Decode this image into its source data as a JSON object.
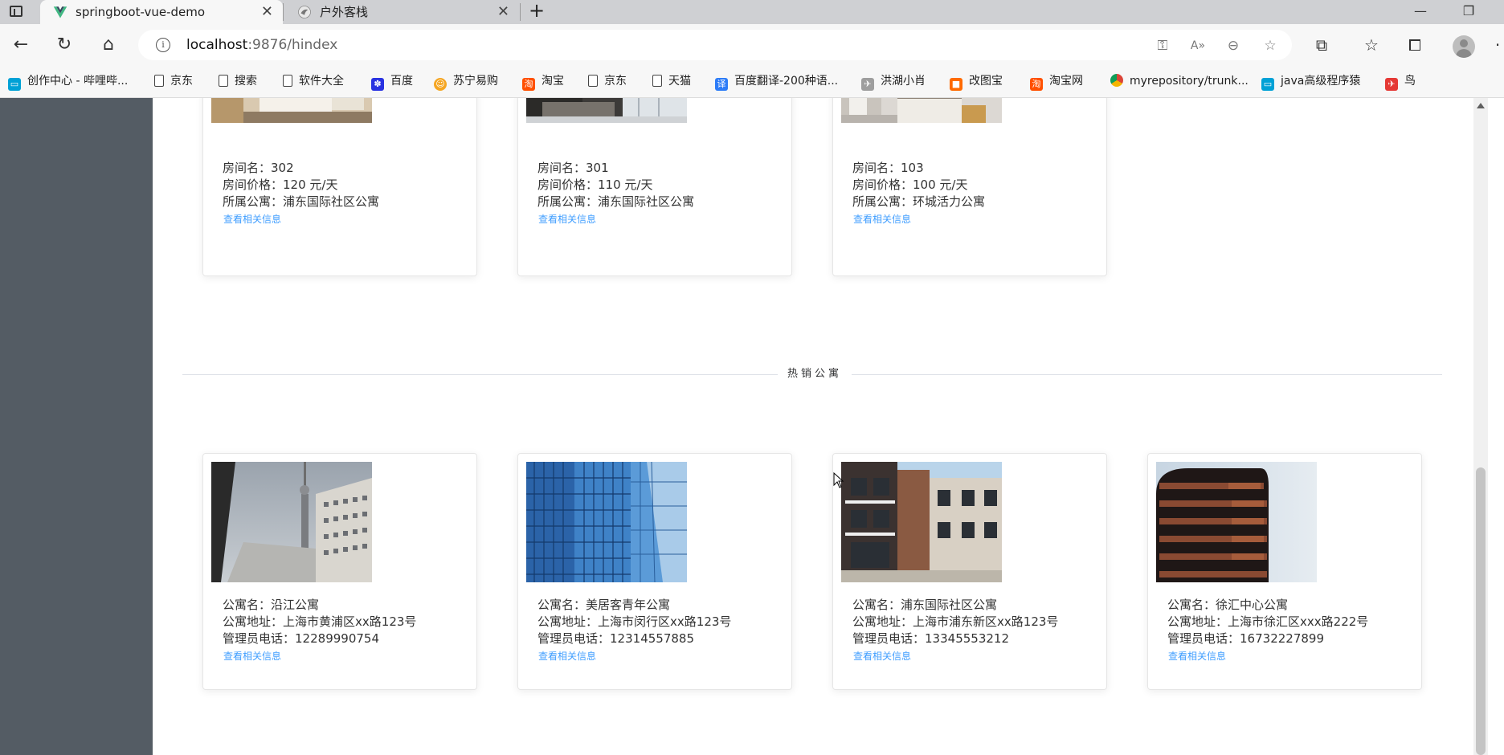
{
  "browser": {
    "tabs": [
      {
        "title": "springboot-vue-demo",
        "active": true,
        "icon": "vue-logo-icon"
      },
      {
        "title": "户外客栈",
        "active": false,
        "icon": "bird-favicon-icon"
      }
    ],
    "address": {
      "host": "localhost",
      "port_path": ":9876/hindex"
    },
    "bookmarks": [
      {
        "label": "创作中心 - 哔哩哔...",
        "icon": "bilibili-icon",
        "color": "#00a1d6"
      },
      {
        "label": "京东",
        "icon": "page-icon"
      },
      {
        "label": "搜索",
        "icon": "page-icon"
      },
      {
        "label": "软件大全",
        "icon": "page-icon"
      },
      {
        "label": "百度",
        "icon": "baidu-paw-icon",
        "color": "#2932e1"
      },
      {
        "label": "苏宁易购",
        "icon": "suning-icon",
        "color": "#f5a623"
      },
      {
        "label": "淘宝",
        "icon": "taobao-icon",
        "color": "#ff5000"
      },
      {
        "label": "京东",
        "icon": "page-icon"
      },
      {
        "label": "天猫",
        "icon": "page-icon"
      },
      {
        "label": "百度翻译-200种语...",
        "icon": "translate-icon",
        "color": "#2d7cf7"
      },
      {
        "label": "洪湖小肖",
        "icon": "bird-icon",
        "color": "#555555"
      },
      {
        "label": "改图宝",
        "icon": "gaitubao-icon",
        "color": "#ff6a00"
      },
      {
        "label": "淘宝网",
        "icon": "taobao-icon",
        "color": "#ff5000"
      },
      {
        "label": "myrepository/trunk...",
        "icon": "chrome-icon",
        "color": "#db4437"
      },
      {
        "label": "java高级程序猿",
        "icon": "bilibili-icon",
        "color": "#00a1d6"
      },
      {
        "label": "鸟",
        "icon": "red-bird-icon",
        "color": "#e53935"
      }
    ]
  },
  "rooms": [
    {
      "name_label": "房间名：",
      "name": "302",
      "price_label": "房间价格：",
      "price": "120 元/天",
      "apt_label": "所属公寓：",
      "apartment": "浦东国际社区公寓",
      "link": "查看相关信息"
    },
    {
      "name_label": "房间名：",
      "name": "301",
      "price_label": "房间价格：",
      "price": "110 元/天",
      "apt_label": "所属公寓：",
      "apartment": "浦东国际社区公寓",
      "link": "查看相关信息"
    },
    {
      "name_label": "房间名：",
      "name": "103",
      "price_label": "房间价格：",
      "price": "100 元/天",
      "apt_label": "所属公寓：",
      "apartment": "环城活力公寓",
      "link": "查看相关信息"
    }
  ],
  "section_title": "热销公寓",
  "apartments": [
    {
      "name_label": "公寓名：",
      "name": "沿江公寓",
      "addr_label": "公寓地址：",
      "address": "上海市黄浦区xx路123号",
      "phone_label": "管理员电话：",
      "phone": "12289990754",
      "link": "查看相关信息"
    },
    {
      "name_label": "公寓名：",
      "name": "美居客青年公寓",
      "addr_label": "公寓地址：",
      "address": "上海市闵行区xx路123号",
      "phone_label": "管理员电话：",
      "phone": "12314557885",
      "link": "查看相关信息"
    },
    {
      "name_label": "公寓名：",
      "name": "浦东国际社区公寓",
      "addr_label": "公寓地址：",
      "address": "上海市浦东新区xx路123号",
      "phone_label": "管理员电话：",
      "phone": "13345553212",
      "link": "查看相关信息"
    },
    {
      "name_label": "公寓名：",
      "name": "徐汇中心公寓",
      "addr_label": "公寓地址：",
      "address": "上海市徐汇区xxx路222号",
      "phone_label": "管理员电话：",
      "phone": "16732227899",
      "link": "查看相关信息"
    }
  ],
  "colors": {
    "sidebar": "#545c64",
    "link": "#409eff",
    "divider": "#dcdfe6"
  }
}
